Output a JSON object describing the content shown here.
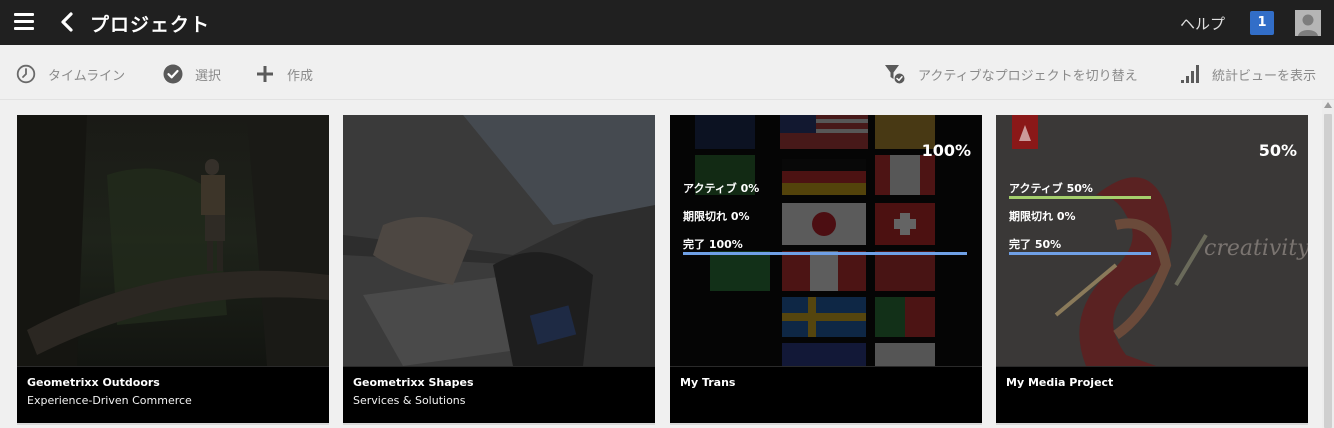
{
  "header": {
    "title": "プロジェクト",
    "help_label": "ヘルプ",
    "notification_count": "1"
  },
  "toolbar": {
    "timeline_label": "タイムライン",
    "select_label": "選択",
    "create_label": "作成",
    "toggle_active_label": "アクティブなプロジェクトを切り替え",
    "stats_view_label": "統計ビューを表示"
  },
  "cards": [
    {
      "title": "Geometrixx Outdoors",
      "subtitle": "Experience-Driven Commerce"
    },
    {
      "title": "Geometrixx Shapes",
      "subtitle": "Services & Solutions"
    },
    {
      "title": "My Trans",
      "percent": "100%",
      "active_label": "アクティブ 0%",
      "overdue_label": "期限切れ 0%",
      "complete_label": "完了 100%",
      "active_fraction": 0,
      "complete_fraction": 1.0
    },
    {
      "title": "My Media Project",
      "percent": "50%",
      "active_label": "アクティブ 50%",
      "overdue_label": "期限切れ 0%",
      "complete_label": "完了 50%",
      "active_fraction": 0.5,
      "complete_fraction": 0.5
    }
  ],
  "colors": {
    "header_bg": "#202020",
    "badge": "#326ec8",
    "active_bar": "#a5cf6c",
    "complete_bar": "#6fa0e6"
  }
}
